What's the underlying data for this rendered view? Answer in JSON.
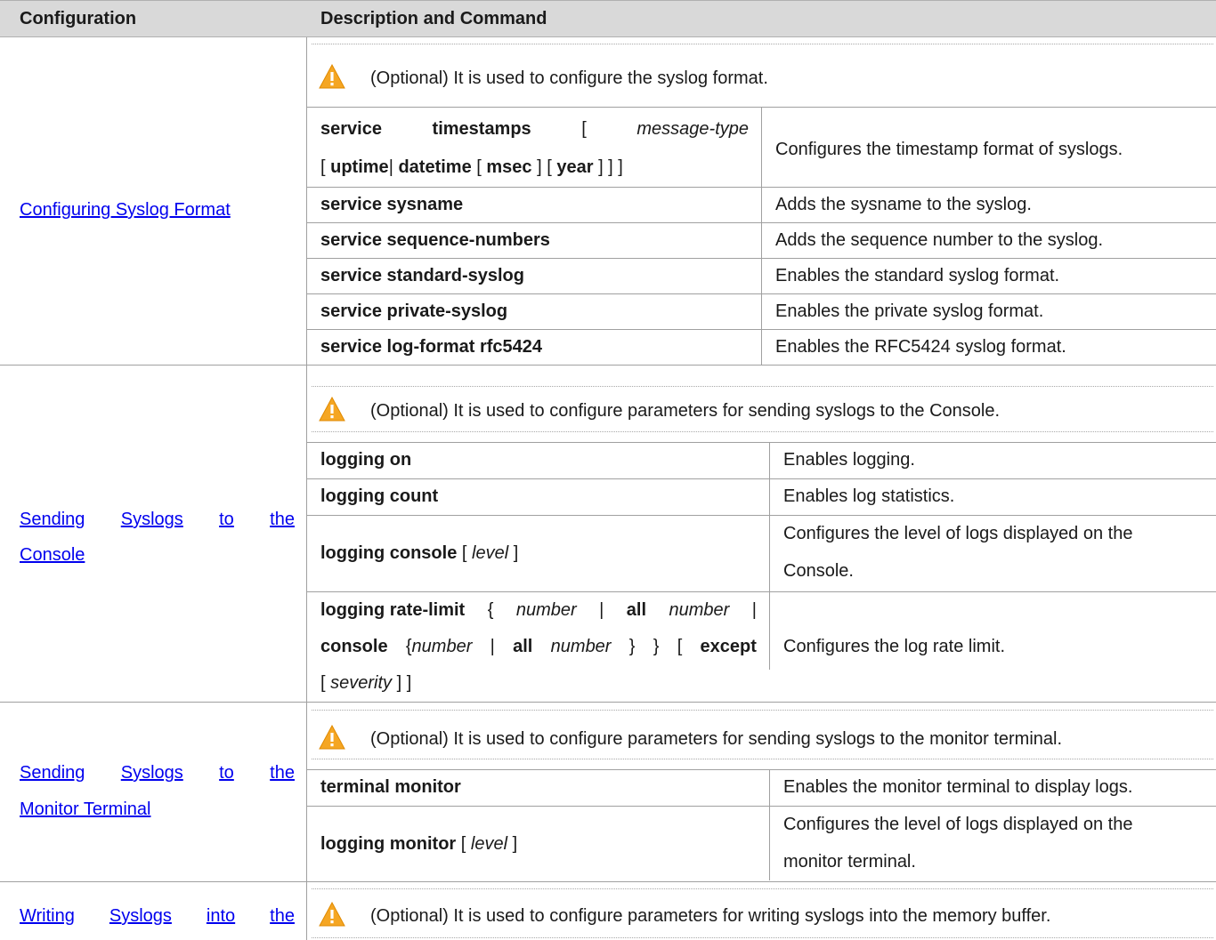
{
  "header": {
    "col1": "Configuration",
    "col2": "Description and Command"
  },
  "sections": [
    {
      "link": "Configuring Syslog Format",
      "note": "(Optional) It is used to configure the syslog format.",
      "rows": [
        {
          "cmd_line1": [
            "service",
            "timestamps",
            "[",
            "message-type"
          ],
          "cmd_line2_parts": [
            "[",
            "uptime",
            "|",
            "datetime",
            "[",
            "msec",
            "] [",
            "year",
            "] ] ]"
          ],
          "desc": "Configures the timestamp format of syslogs."
        },
        {
          "cmd": "service sysname",
          "desc": "Adds the sysname to the syslog."
        },
        {
          "cmd": "service sequence-numbers",
          "desc": "Adds the sequence number to the syslog."
        },
        {
          "cmd": "service standard-syslog",
          "desc": "Enables the standard syslog format."
        },
        {
          "cmd": "service private-syslog",
          "desc": "Enables the private syslog format."
        },
        {
          "cmd": "service log-format rfc5424",
          "desc": "Enables the RFC5424 syslog format."
        }
      ]
    },
    {
      "link_line1": [
        "Sending",
        "Syslogs",
        "to",
        "the"
      ],
      "link_line2": "Console",
      "note": "(Optional) It is used to configure parameters for sending syslogs to the Console.",
      "rows": [
        {
          "cmd": "logging on",
          "desc": "Enables logging."
        },
        {
          "cmd": "logging count",
          "desc": "Enables log statistics."
        },
        {
          "cmd_bold": "logging console",
          "cmd_open": "[",
          "cmd_italic": "level",
          "cmd_close": "]",
          "desc_line1": "Configures the level of logs displayed on the",
          "desc_line2": "Console."
        },
        {
          "cmd_line1": [
            "logging rate-limit",
            "{",
            "number",
            "|",
            "all",
            "number",
            "|"
          ],
          "cmd_line2": [
            "console",
            "{",
            "number",
            "|",
            "all",
            "number",
            "}",
            "}",
            "[",
            "except"
          ],
          "cmd_line3": [
            "[",
            "severity",
            "] ]"
          ],
          "desc": "Configures the log rate limit."
        }
      ]
    },
    {
      "link_line1": [
        "Sending",
        "Syslogs",
        "to",
        "the"
      ],
      "link_line2": "Monitor Terminal",
      "note": "(Optional) It is used to configure parameters for sending syslogs to the monitor terminal.",
      "rows": [
        {
          "cmd": "terminal monitor",
          "desc": "Enables the monitor terminal to display logs."
        },
        {
          "cmd_bold": "logging monitor",
          "cmd_open": "[",
          "cmd_italic": "level",
          "cmd_close": "]",
          "desc_line1": "Configures the level of logs displayed on the",
          "desc_line2": "monitor terminal."
        }
      ]
    },
    {
      "link_line1": [
        "Writing",
        "Syslogs",
        "into",
        "the"
      ],
      "note": "(Optional) It is used to configure parameters for writing syslogs into the memory buffer."
    }
  ],
  "icons": {
    "warning": "warning-triangle-icon",
    "warning_color": "#f5a623"
  }
}
